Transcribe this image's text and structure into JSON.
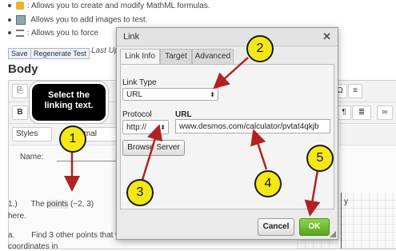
{
  "page": {
    "bullets": [
      {
        "text": ": Allows you to create and modify MathML formulas.",
        "icon": "mathml-icon"
      },
      {
        "text": " Allows you to add images to test.",
        "icon": "image-icon"
      },
      {
        "text": ": Allows you to force",
        "icon": "list-icon"
      }
    ],
    "save_label": "Save",
    "regenerate_label": "Regenerate Test",
    "last_updated": "Last Up",
    "body_heading": "Body",
    "styles_label": "Styles",
    "format_label": "ormal",
    "bold_label": "B",
    "omega_label": "Ω",
    "name_label": "Name:",
    "content_line1_num": "1.)",
    "content_line1_pre": "The",
    "content_line1_hl": "points",
    "content_line1_post": "(−2, 3)",
    "content_line2": "here.",
    "content_line3_num": "a.",
    "content_line3": "Find 3 other points that would also fall on this line.  Write their",
    "content_line4": "coordinates in",
    "graph_axis_label": "y"
  },
  "callout": {
    "text_line1": "Select the",
    "text_line2": "linking text."
  },
  "dialog": {
    "title": "Link",
    "close": "✕",
    "tabs": [
      "Link Info",
      "Target",
      "Advanced"
    ],
    "link_type_label": "Link Type",
    "link_type_value": "URL",
    "protocol_label": "Protocol",
    "protocol_value": "http://",
    "url_label": "URL",
    "url_value": "www.desmos.com/calculator/pvtat4qkjb",
    "browse_label": "Browse Server",
    "cancel_label": "Cancel",
    "ok_label": "OK"
  },
  "markers": [
    "1",
    "2",
    "3",
    "4",
    "5"
  ],
  "colors": {
    "marker_fill": "#f5e817",
    "arrow": "#b22222",
    "ok_green": "#5aa61e"
  }
}
